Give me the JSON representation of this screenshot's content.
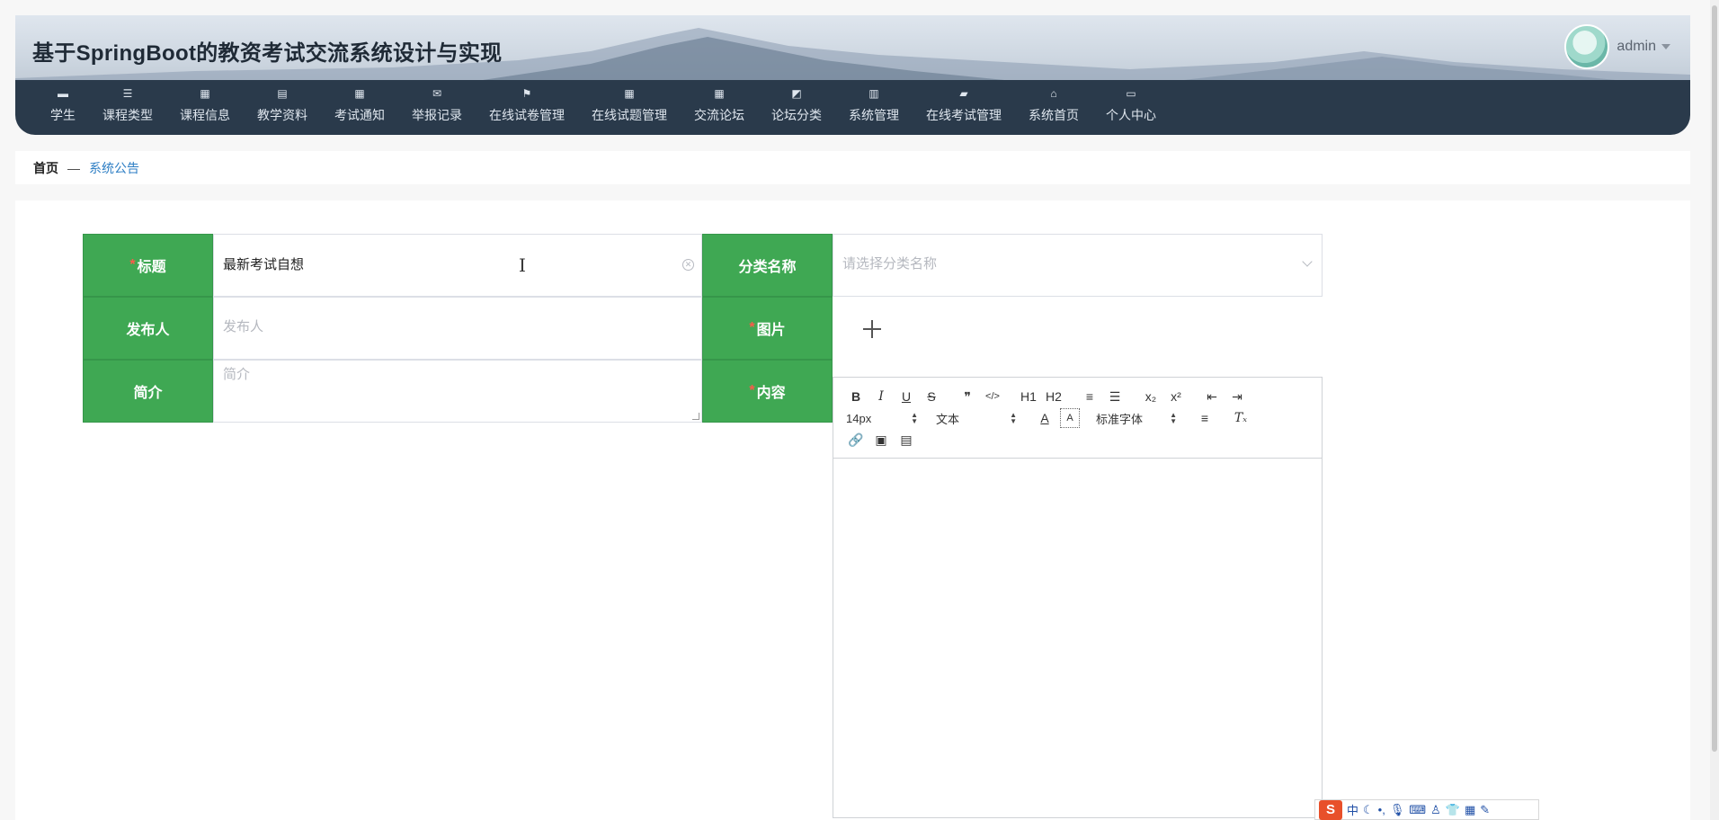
{
  "header": {
    "title": "基于SpringBoot的教资考试交流系统设计与实现",
    "username": "admin"
  },
  "nav": [
    {
      "label": "学生",
      "icon": "user-icon"
    },
    {
      "label": "课程类型",
      "icon": "sliders-icon"
    },
    {
      "label": "课程信息",
      "icon": "grid-icon"
    },
    {
      "label": "教学资料",
      "icon": "clipboard-icon"
    },
    {
      "label": "考试通知",
      "icon": "grid-icon"
    },
    {
      "label": "举报记录",
      "icon": "mailbox-icon"
    },
    {
      "label": "在线试卷管理",
      "icon": "flag-icon"
    },
    {
      "label": "在线试题管理",
      "icon": "grid-icon"
    },
    {
      "label": "交流论坛",
      "icon": "grid-icon"
    },
    {
      "label": "论坛分类",
      "icon": "chart-icon"
    },
    {
      "label": "系统管理",
      "icon": "bar-chart-icon"
    },
    {
      "label": "在线考试管理",
      "icon": "ticket-icon"
    },
    {
      "label": "系统首页",
      "icon": "home-icon"
    },
    {
      "label": "个人中心",
      "icon": "card-icon"
    }
  ],
  "breadcrumb": {
    "home": "首页",
    "separator": "—",
    "current": "系统公告"
  },
  "form": {
    "title_label": "标题",
    "title_value": "最新考试自想",
    "category_label": "分类名称",
    "category_placeholder": "请选择分类名称",
    "publisher_label": "发布人",
    "publisher_placeholder": "发布人",
    "image_label": "图片",
    "summary_label": "简介",
    "summary_placeholder": "简介",
    "content_label": "内容",
    "required_mark": "*"
  },
  "editor": {
    "font_size": "14px",
    "block_format": "文本",
    "font_family": "标准字体",
    "toolbar_row1": [
      "B",
      "I",
      "U",
      "S",
      "❞",
      "</>",
      "H1",
      "H2",
      "ol",
      "ul",
      "x₂",
      "x²",
      "outdent",
      "indent"
    ]
  },
  "ime": {
    "logo": "S",
    "mode": "中"
  },
  "colors": {
    "label_green": "#3fa853",
    "nav_bg": "#2a3a4b",
    "link_blue": "#2d7ec4",
    "required_red": "#ff5a4a"
  }
}
